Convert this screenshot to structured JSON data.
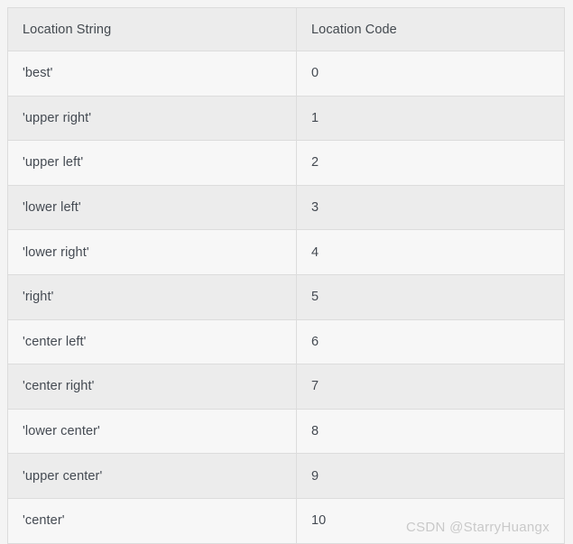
{
  "table": {
    "headers": {
      "location_string": "Location String",
      "location_code": "Location Code"
    },
    "rows": [
      {
        "string": "'best'",
        "code": "0"
      },
      {
        "string": "'upper right'",
        "code": "1"
      },
      {
        "string": "'upper left'",
        "code": "2"
      },
      {
        "string": "'lower left'",
        "code": "3"
      },
      {
        "string": "'lower right'",
        "code": "4"
      },
      {
        "string": "'right'",
        "code": "5"
      },
      {
        "string": "'center left'",
        "code": "6"
      },
      {
        "string": "'center right'",
        "code": "7"
      },
      {
        "string": "'lower center'",
        "code": "8"
      },
      {
        "string": "'upper center'",
        "code": "9"
      },
      {
        "string": "'center'",
        "code": "10"
      }
    ]
  },
  "watermark": {
    "text": "CSDN @StarryHuangx"
  },
  "colors": {
    "page_background": "#f4f4f4",
    "header_background": "#ececec",
    "row_odd_background": "#f7f7f7",
    "row_even_background": "#ececec",
    "border": "#dcdcdc",
    "text": "#444a52",
    "watermark_text": "#c9c9c9"
  }
}
